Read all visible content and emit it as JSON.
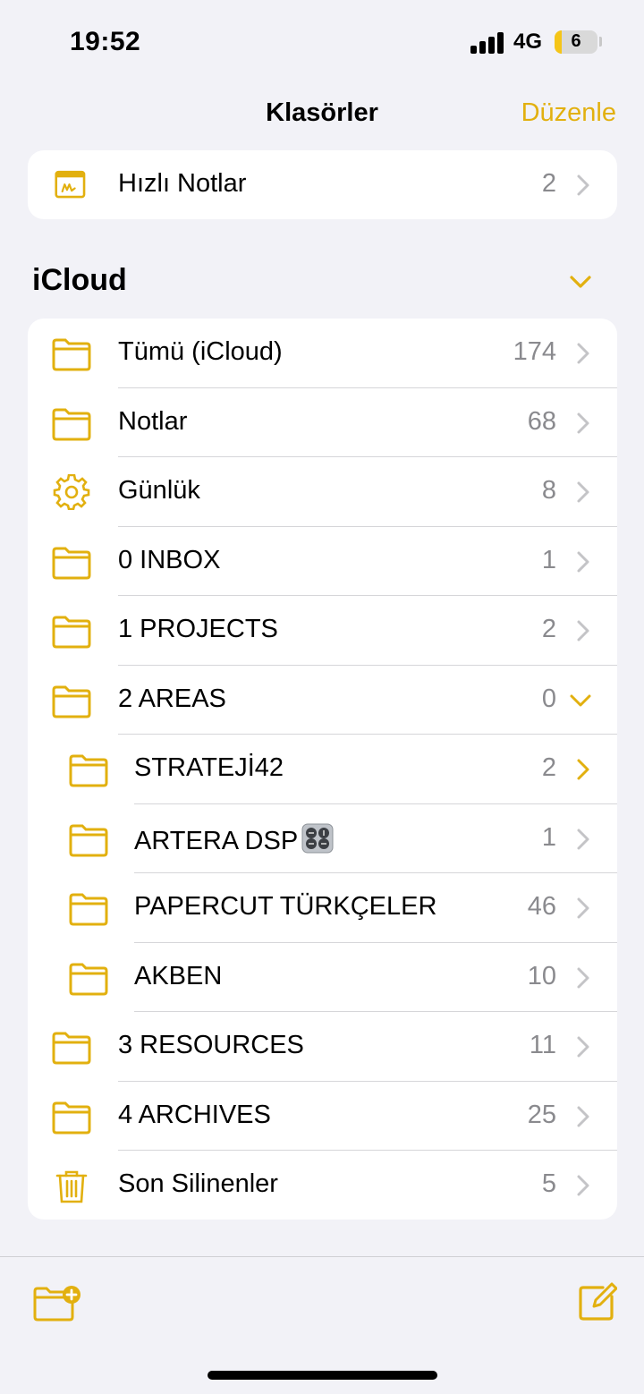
{
  "status": {
    "time": "19:52",
    "network": "4G",
    "battery": "6"
  },
  "nav": {
    "title": "Klasörler",
    "edit": "Düzenle"
  },
  "quick_notes": {
    "label": "Hızlı Notlar",
    "count": "2"
  },
  "section": {
    "title": "iCloud"
  },
  "folders": [
    {
      "label": "Tümü (iCloud)",
      "count": "174",
      "icon": "folder-icon"
    },
    {
      "label": "Notlar",
      "count": "68",
      "icon": "folder-icon"
    },
    {
      "label": "Günlük",
      "count": "8",
      "icon": "gear-icon"
    },
    {
      "label": "0 INBOX",
      "count": "1",
      "icon": "folder-icon"
    },
    {
      "label": "1 PROJECTS",
      "count": "2",
      "icon": "folder-icon"
    },
    {
      "label": "2 AREAS",
      "count": "0",
      "icon": "folder-icon",
      "expanded": true
    },
    {
      "label": "STRATEJİ42",
      "count": "2",
      "icon": "folder-icon",
      "sub": true
    },
    {
      "label": "ARTERA DSP",
      "count": "1",
      "icon": "folder-icon",
      "sub": true,
      "emoji": "control-knobs-icon"
    },
    {
      "label": "PAPERCUT TÜRKÇELER",
      "count": "46",
      "icon": "folder-icon",
      "sub": true
    },
    {
      "label": "AKBEN",
      "count": "10",
      "icon": "folder-icon",
      "sub": true
    },
    {
      "label": "3 RESOURCES",
      "count": "11",
      "icon": "folder-icon"
    },
    {
      "label": "4 ARCHIVES",
      "count": "25",
      "icon": "folder-icon"
    },
    {
      "label": "Son Silinenler",
      "count": "5",
      "icon": "trash-icon"
    }
  ],
  "colors": {
    "accent": "#e2b00f",
    "background": "#f2f2f7",
    "count": "#8a8a8e"
  }
}
